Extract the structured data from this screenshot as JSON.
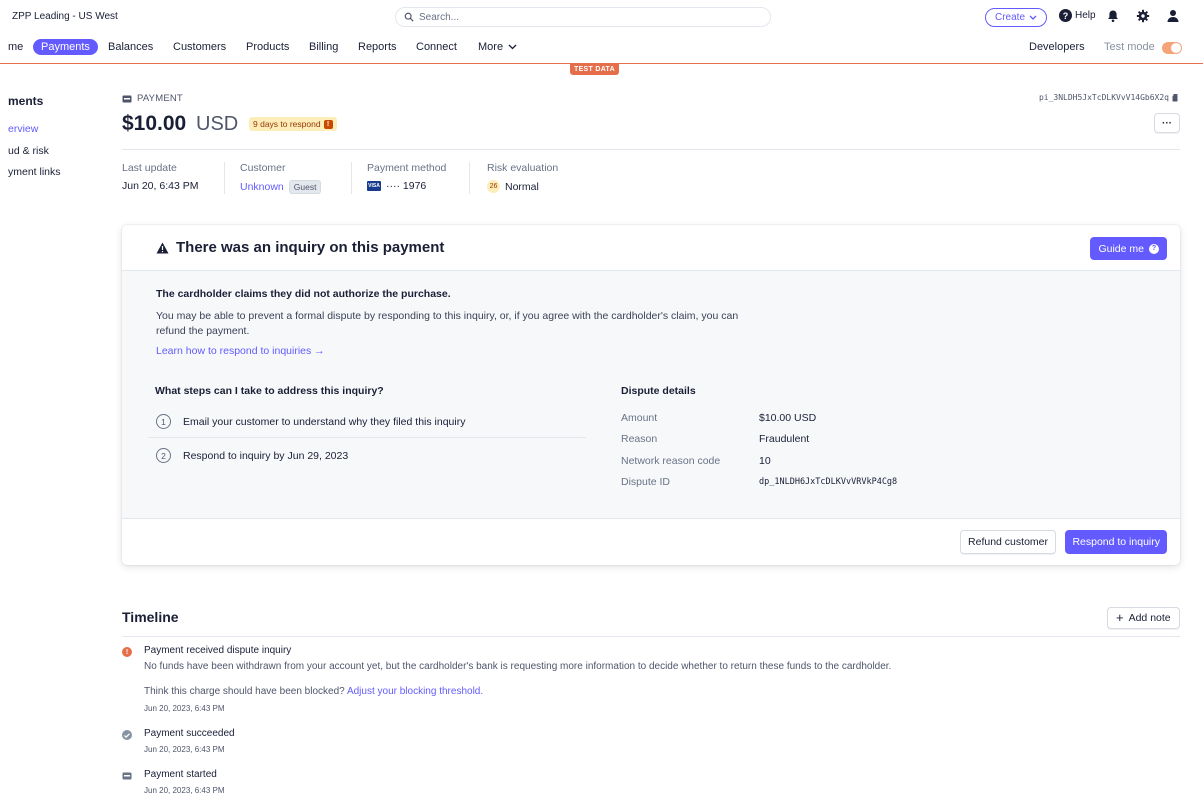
{
  "topbar": {
    "account_name": "ZPP Leading - US West",
    "search_placeholder": "Search...",
    "create_label": "Create",
    "help_label": "Help"
  },
  "nav": {
    "items": [
      "me",
      "Payments",
      "Balances",
      "Customers",
      "Products",
      "Billing",
      "Reports",
      "Connect",
      "More"
    ],
    "developers_label": "Developers",
    "test_mode_label": "Test mode",
    "test_data_badge": "TEST DATA"
  },
  "sidebar": {
    "title": "ments",
    "links": [
      "erview",
      "ud & risk",
      "yment links"
    ]
  },
  "payment": {
    "kicker": "PAYMENT",
    "id": "pi_3NLDH5JxTcDLKVvV14Gb6X2q",
    "amount": "$10.00",
    "currency": "USD",
    "respond_badge": "9 days to respond",
    "badge_mark": "!",
    "more_label": "···",
    "meta": {
      "last_update_label": "Last update",
      "last_update_value": "Jun 20, 6:43 PM",
      "customer_label": "Customer",
      "customer_value": "Unknown",
      "customer_tag": "Guest",
      "method_label": "Payment method",
      "card_brand": "VISA",
      "card_value": "···· 1976",
      "risk_label": "Risk evaluation",
      "risk_score": "26",
      "risk_value": "Normal"
    }
  },
  "inquiry": {
    "title": "There was an inquiry on this payment",
    "guide_label": "Guide me",
    "claim": "The cardholder claims they did not authorize the purchase.",
    "description": "You may be able to prevent a formal dispute by responding to this inquiry, or, if you agree with the cardholder's claim, you can refund the payment.",
    "learn_link": "Learn how to respond to inquiries →",
    "steps_title": "What steps can I take to address this inquiry?",
    "steps": [
      {
        "num": "1",
        "text": "Email your customer to understand why they filed this inquiry"
      },
      {
        "num": "2",
        "text": "Respond to inquiry by Jun 29, 2023"
      }
    ],
    "details_title": "Dispute details",
    "details": [
      {
        "key": "Amount",
        "value": "$10.00 USD"
      },
      {
        "key": "Reason",
        "value": "Fraudulent"
      },
      {
        "key": "Network reason code",
        "value": "10"
      },
      {
        "key": "Dispute ID",
        "value": "dp_1NLDH6JxTcDLKVvVRVkP4Cg8"
      }
    ],
    "refund_label": "Refund customer",
    "respond_label": "Respond to inquiry"
  },
  "timeline": {
    "title": "Timeline",
    "add_note_label": "Add note",
    "events": [
      {
        "title": "Payment received dispute inquiry",
        "detail": "No funds have been withdrawn from your account yet, but the cardholder's bank is requesting more information to decide whether to return these funds to the cardholder.",
        "hint": "Think this charge should have been blocked?",
        "hint_link": "Adjust your blocking threshold.",
        "date": "Jun 20, 2023, 6:43 PM"
      },
      {
        "title": "Payment succeeded",
        "date": "Jun 20, 2023, 6:43 PM"
      },
      {
        "title": "Payment started",
        "date": "Jun 20, 2023, 6:43 PM"
      }
    ]
  },
  "colors": {
    "accent": "#635bff",
    "test_mode": "#e56f4a",
    "warning": "#c84801"
  }
}
